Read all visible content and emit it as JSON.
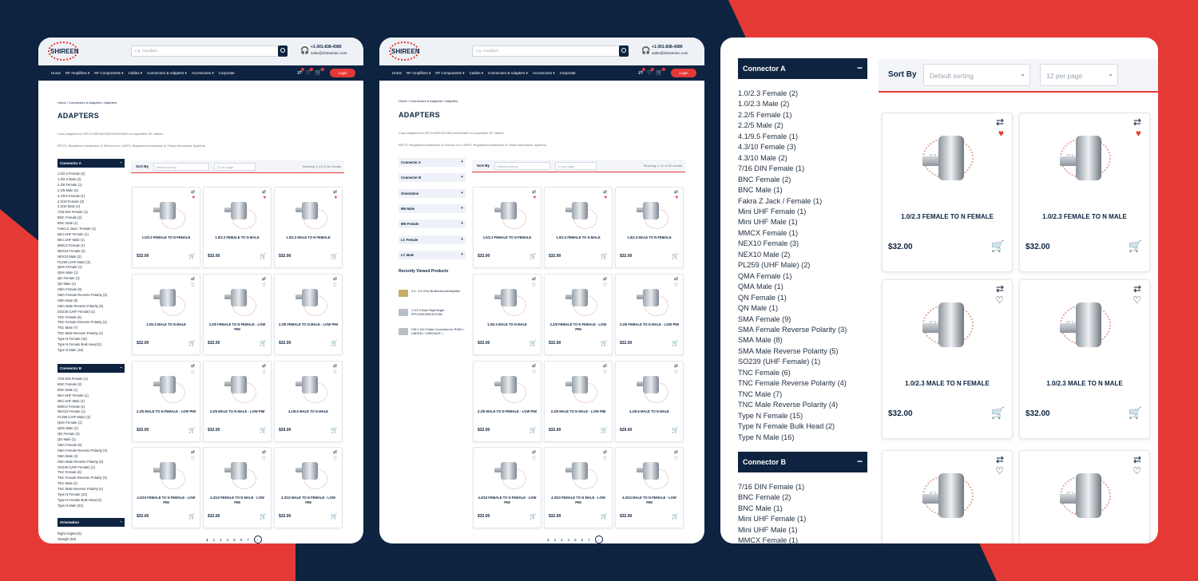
{
  "brand": "SHIREEN",
  "header": {
    "search_placeholder": "e.g. Amplifiers",
    "phone": "+1-301-838-4380",
    "email": "sales@shireeninc.com",
    "nav": [
      "Home",
      "RF Amplifiers ▾",
      "RF Components ▾",
      "Cables ▾",
      "Connectors & Adapters ▾",
      "Accessories ▾",
      "Corporate"
    ],
    "login": "Login"
  },
  "breadcrumb": "Home / Connectors & Adapters / Adapters",
  "page_title": "ADAPTERS",
  "desc1": "Coax adapters for RFC/LMR100/195/240/400/600 or equivalent RF cables.",
  "desc2": "RFC®, Registered trademark of Shireen Inc; LMR®, Registered trademark of Times Microwave Systems",
  "sort": {
    "label": "Sort By",
    "default": "Default sorting",
    "per_page": "12 per page",
    "count": "Showing 1–12 of 62 results"
  },
  "filters": {
    "a_title": "Connector A",
    "a_items": [
      "1.0/2.3 Female (2)",
      "1.0/2.3 Male (2)",
      "2.2/5 Female (1)",
      "2.2/5 Male (2)",
      "4.1/9.5 Female (1)",
      "4.3/10 Female (3)",
      "4.3/10 Male (2)",
      "7/16 DIN Female (1)",
      "BNC Female (2)",
      "BNC Male (1)",
      "Fakra Z Jack / Female (1)",
      "Mini UHF Female (1)",
      "Mini UHF Male (1)",
      "MMCX Female (1)",
      "NEX10 Female (3)",
      "NEX10 Male (2)",
      "PL259 (UHF Male) (2)",
      "QMA Female (1)",
      "QMA Male (1)",
      "QN Female (1)",
      "QN Male (1)",
      "SMA Female (9)",
      "SMA Female Reverse Polarity (3)",
      "SMA Male (8)",
      "SMA Male Reverse Polarity (5)",
      "SO239 (UHF Female) (1)",
      "TNC Female (6)",
      "TNC Female Reverse Polarity (4)",
      "TNC Male (7)",
      "TNC Male Reverse Polarity (4)",
      "Type N Female (15)",
      "Type N Female Bulk Head (2)",
      "Type N Male (16)"
    ],
    "b_title": "Connector B",
    "b_items": [
      "7/16 DIN Female (1)",
      "BNC Female (2)",
      "BNC Male (1)",
      "Mini UHF Female (1)",
      "Mini UHF Male (1)",
      "MMCX Female (1)",
      "NEX10 Female (1)",
      "PL259 (UHF Male) (2)",
      "QMA Female (1)",
      "QMA Male (2)",
      "QN Female (1)",
      "QN Male (1)",
      "SMA Female (5)",
      "SMA Female Reverse Polarity (3)",
      "SMA Male (3)",
      "SMA Male Reverse Polarity (5)",
      "SO239 (UHF Female) (1)",
      "TNC Female (6)",
      "TNC Female Reverse Polarity (4)",
      "TNC Male (1)",
      "TNC Male Reverse Polarity (4)",
      "Type N Female (23)",
      "Type N Female Bulk Head (2)",
      "Type N Male (24)"
    ],
    "c_title": "Orientation",
    "c_items": [
      "Right Angled (5)",
      "Straight (59)"
    ],
    "accordion": [
      "Connector A",
      "Connector B",
      "Orientation",
      "MN Male",
      "MN Female",
      "LC Female",
      "LC Male"
    ]
  },
  "recent": {
    "title": "Recently Viewed Products",
    "items": [
      "2.4 - 6.0 GHz Bi-directional Amplifier",
      "1.0/2.3 Male Right Angle - RFC240/LMR240/195s",
      "DIN 1.0/2.3 Male Connector for RG8U / LMR240 / LMR240UF /..."
    ]
  },
  "products": [
    {
      "name": "1.0/2.3 FEMALE TO N FEMALE",
      "price": "$32.00",
      "fav": true
    },
    {
      "name": "1.0/2.3 FEMALE TO N MALE",
      "price": "$32.00",
      "fav": true
    },
    {
      "name": "1.0/2.3 MALE TO N FEMALE",
      "price": "$32.00",
      "fav": true
    },
    {
      "name": "1.0/2.3 MALE TO N MALE",
      "price": "$32.00",
      "fav": false
    },
    {
      "name": "2.2/5 FEMALE TO N FEMALE - LOW PIM",
      "price": "$32.00",
      "fav": false
    },
    {
      "name": "2.2/5 FEMALE TO N MALE - LOW PIM",
      "price": "$32.00",
      "fav": false
    },
    {
      "name": "2.2/5 MALE TO N FEMALE - LOW PIM",
      "price": "$32.00",
      "fav": false
    },
    {
      "name": "2.2/5 MALE TO N MALE - LOW PIM",
      "price": "$32.00",
      "fav": false
    },
    {
      "name": "4.1/9.5 MALE TO N MALE",
      "price": "$29.00",
      "fav": false
    },
    {
      "name": "4.3/10 FEMALE TO N FEMALE - LOW PIM",
      "price": "$32.00",
      "fav": false
    },
    {
      "name": "4.3/10 FEMALE TO N MALE - LOW PIM",
      "price": "$32.00",
      "fav": false
    },
    {
      "name": "4.3/10 MALE TO N FEMALE - LOW PIM",
      "price": "$32.00",
      "fav": false
    }
  ],
  "pager": [
    "1",
    "2",
    "3",
    "4",
    "5",
    "6",
    "7"
  ],
  "icons": {
    "compare": "compare-icon",
    "wishlist": "heart-icon",
    "cart": "cart-icon",
    "next": "chevron-right-icon"
  },
  "colors": {
    "navy": "#0d2340",
    "red": "#e53936"
  }
}
